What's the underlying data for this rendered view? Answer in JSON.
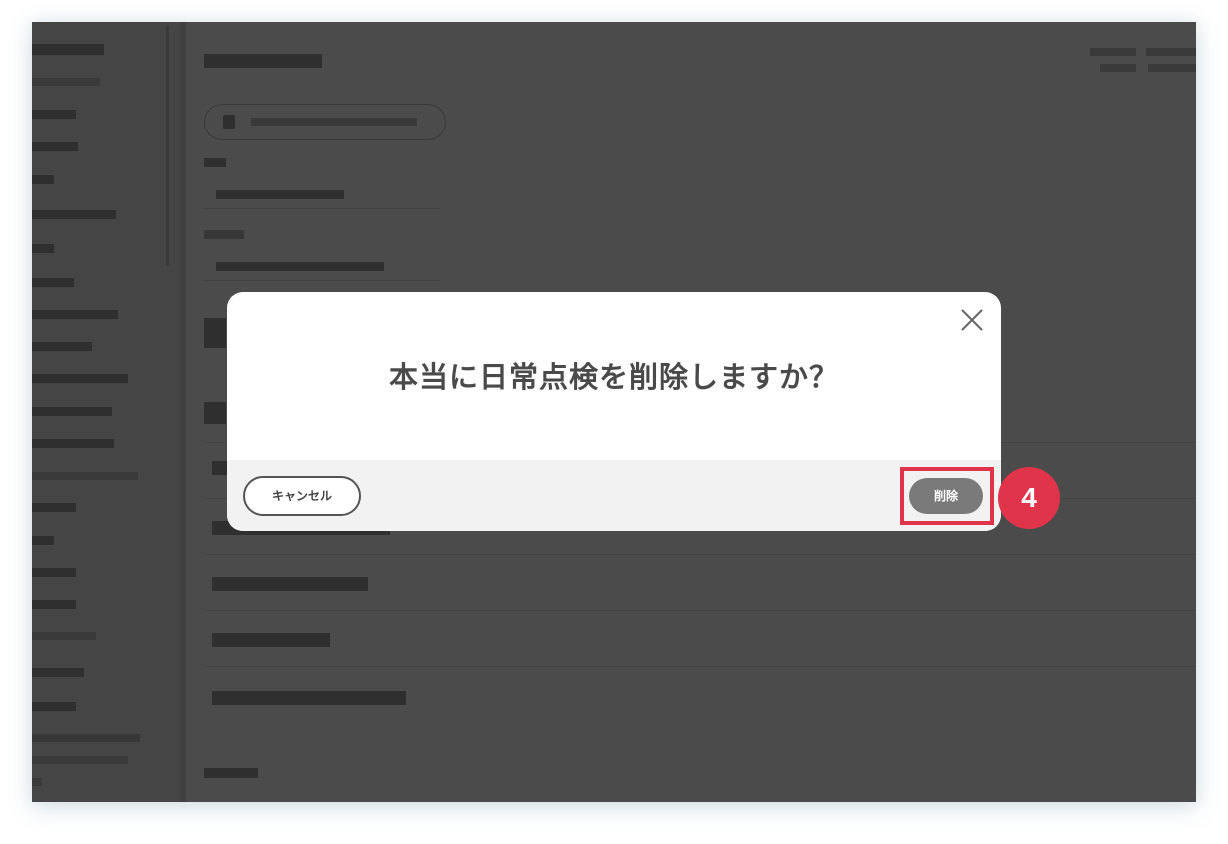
{
  "dialog": {
    "title": "本当に日常点検を削除しますか？",
    "cancel_label": "キャンセル",
    "delete_label": "削除"
  },
  "annotation": {
    "step_number": "4",
    "highlight_color": "#e0344b"
  },
  "icons": {
    "close": "close-icon"
  }
}
